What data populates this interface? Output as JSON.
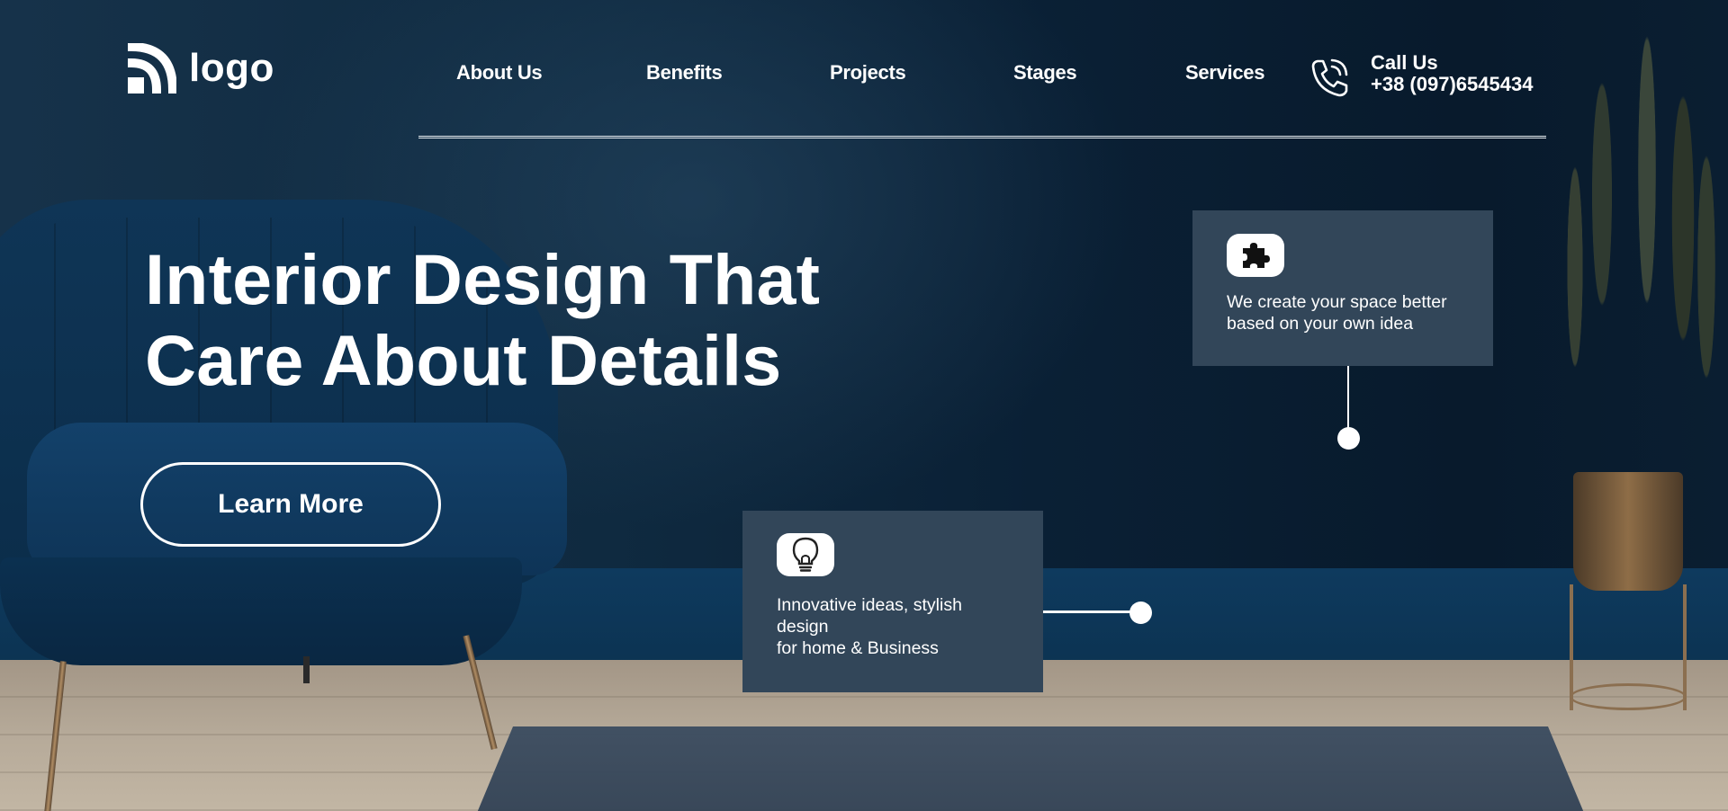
{
  "header": {
    "logo_text": "logo",
    "nav": [
      {
        "label": "About Us"
      },
      {
        "label": "Benefits"
      },
      {
        "label": "Projects"
      },
      {
        "label": "Stages"
      },
      {
        "label": "Services"
      }
    ],
    "call": {
      "title": "Call Us",
      "number": "+38 (097)6545434",
      "icon": "phone-icon"
    }
  },
  "hero": {
    "title_line1": "Interior Design That",
    "title_line2": "Care About Details",
    "cta_label": "Learn More"
  },
  "cards": [
    {
      "icon": "puzzle-icon",
      "line1": "We create your space better",
      "line2": "based on your own idea"
    },
    {
      "icon": "lightbulb-icon",
      "line1": "Innovative ideas, stylish",
      "line2": "design",
      "line3": "for home & Business"
    }
  ],
  "colors": {
    "card_bg": "#324659",
    "wall": "#0c2236",
    "text": "#ffffff"
  }
}
